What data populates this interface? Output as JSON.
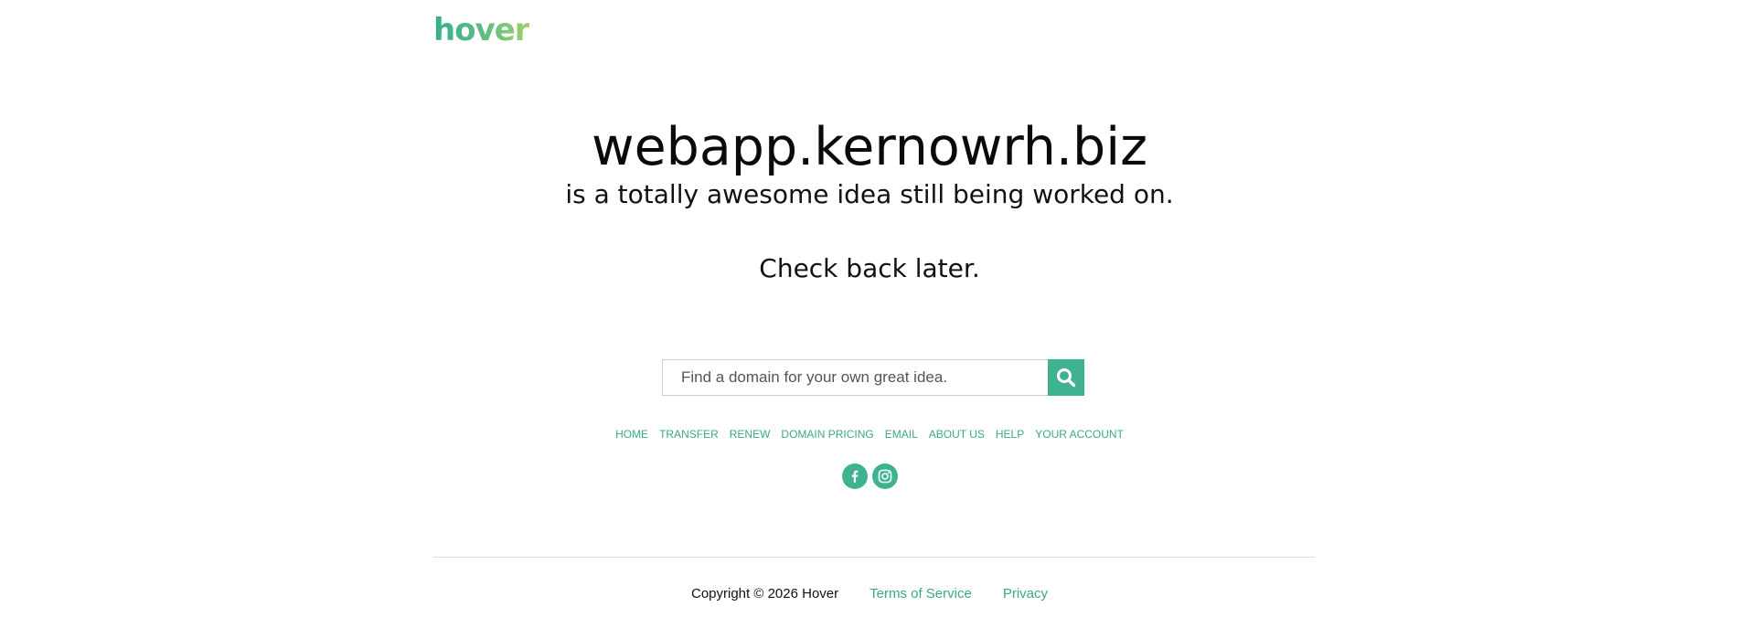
{
  "brand": {
    "logo_text": "hover",
    "accent_color": "#3fb391",
    "logo_gradient": [
      "#36b08f",
      "#9cd06b"
    ]
  },
  "hero": {
    "domain": "webapp.kernowrh.biz",
    "subtitle": "is a totally awesome idea still being worked on.",
    "message": "Check back later."
  },
  "search": {
    "placeholder": "Find a domain for your own great idea.",
    "value": "",
    "button_icon": "search-icon"
  },
  "nav": {
    "items": [
      {
        "label": "HOME"
      },
      {
        "label": "TRANSFER"
      },
      {
        "label": "RENEW"
      },
      {
        "label": "DOMAIN PRICING"
      },
      {
        "label": "EMAIL"
      },
      {
        "label": "ABOUT US"
      },
      {
        "label": "HELP"
      },
      {
        "label": "YOUR ACCOUNT"
      }
    ]
  },
  "social": {
    "items": [
      {
        "icon": "facebook-icon"
      },
      {
        "icon": "instagram-icon"
      }
    ]
  },
  "footer": {
    "copyright": "Copyright © 2026 Hover",
    "links": [
      {
        "label": "Terms of Service"
      },
      {
        "label": "Privacy"
      }
    ]
  }
}
